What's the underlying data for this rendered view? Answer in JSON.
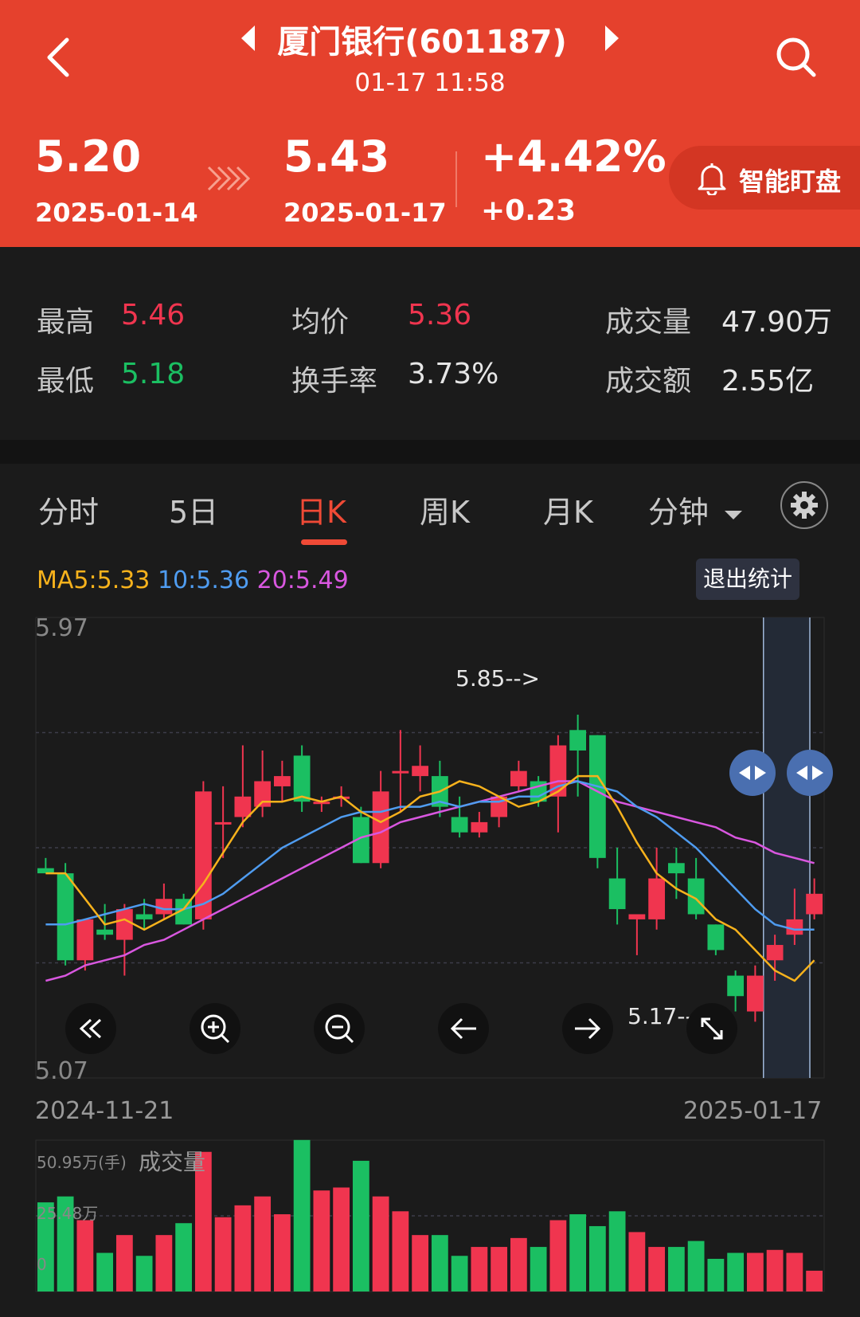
{
  "header": {
    "title": "厦门银行(601187)",
    "datetime": "01-17 11:58",
    "prev_price": "5.20",
    "prev_date": "2025-01-14",
    "cur_price": "5.43",
    "cur_date": "2025-01-17",
    "change_pct": "+4.42%",
    "change_abs": "+0.23",
    "smart_btn": "智能盯盘"
  },
  "stats": {
    "high_label": "最高",
    "high": "5.46",
    "avg_label": "均价",
    "avg": "5.36",
    "vol_label": "成交量",
    "vol": "47.90万",
    "low_label": "最低",
    "low": "5.18",
    "turn_label": "换手率",
    "turn": "3.73%",
    "amt_label": "成交额",
    "amt": "2.55亿"
  },
  "tabs": [
    "分时",
    "5日",
    "日K",
    "周K",
    "月K",
    "分钟"
  ],
  "active_tab": 2,
  "ma": {
    "ma5": "MA5:5.33",
    "ma10": "10:5.36",
    "ma20": "20:5.49"
  },
  "exit_stats": "退出统计",
  "price_axis": {
    "top": "5.97",
    "bottom": "5.07"
  },
  "annotations": {
    "high": "5.85-->",
    "low": "5.17-->"
  },
  "date_axis": {
    "start": "2024-11-21",
    "end": "2025-01-17"
  },
  "volume": {
    "max_label": "50.95万(手)",
    "title": "成交量",
    "mid_label": "25.48万",
    "zero_label": "0"
  },
  "colors": {
    "up": "#f0354f",
    "down": "#1bbf62",
    "ma5": "#f7b21c",
    "ma10": "#4f9cf0",
    "ma20": "#d957e0",
    "header": "#e5412d"
  },
  "icons": [
    "back-icon",
    "prev-stock-icon",
    "next-stock-icon",
    "search-icon",
    "double-chevron-right-icon",
    "bell-icon",
    "settings-gear-icon",
    "dropdown-arrow-icon",
    "rewind-icon",
    "zoom-in-icon",
    "zoom-out-icon",
    "arrow-left-icon",
    "arrow-right-icon",
    "expand-icon"
  ],
  "chart_data": {
    "type": "candlestick",
    "y_range": [
      5.07,
      5.97
    ],
    "candles": [
      {
        "o": 5.48,
        "c": 5.47,
        "h": 5.5,
        "l": 5.47
      },
      {
        "o": 5.47,
        "c": 5.3,
        "h": 5.49,
        "l": 5.29
      },
      {
        "o": 5.3,
        "c": 5.38,
        "h": 5.38,
        "l": 5.28
      },
      {
        "o": 5.36,
        "c": 5.35,
        "h": 5.41,
        "l": 5.34
      },
      {
        "o": 5.34,
        "c": 5.4,
        "h": 5.41,
        "l": 5.27
      },
      {
        "o": 5.39,
        "c": 5.38,
        "h": 5.42,
        "l": 5.36
      },
      {
        "o": 5.39,
        "c": 5.42,
        "h": 5.45,
        "l": 5.38
      },
      {
        "o": 5.42,
        "c": 5.37,
        "h": 5.43,
        "l": 5.37
      },
      {
        "o": 5.38,
        "c": 5.63,
        "h": 5.65,
        "l": 5.36
      },
      {
        "o": 5.57,
        "c": 5.57,
        "h": 5.64,
        "l": 5.5
      },
      {
        "o": 5.58,
        "c": 5.62,
        "h": 5.72,
        "l": 5.56
      },
      {
        "o": 5.6,
        "c": 5.65,
        "h": 5.71,
        "l": 5.58
      },
      {
        "o": 5.64,
        "c": 5.66,
        "h": 5.69,
        "l": 5.61
      },
      {
        "o": 5.7,
        "c": 5.61,
        "h": 5.72,
        "l": 5.59
      },
      {
        "o": 5.61,
        "c": 5.61,
        "h": 5.62,
        "l": 5.59
      },
      {
        "o": 5.62,
        "c": 5.62,
        "h": 5.64,
        "l": 5.6
      },
      {
        "o": 5.58,
        "c": 5.49,
        "h": 5.6,
        "l": 5.49
      },
      {
        "o": 5.49,
        "c": 5.63,
        "h": 5.67,
        "l": 5.48
      },
      {
        "o": 5.67,
        "c": 5.67,
        "h": 5.75,
        "l": 5.59
      },
      {
        "o": 5.66,
        "c": 5.68,
        "h": 5.72,
        "l": 5.63
      },
      {
        "o": 5.66,
        "c": 5.6,
        "h": 5.69,
        "l": 5.58
      },
      {
        "o": 5.58,
        "c": 5.55,
        "h": 5.62,
        "l": 5.54
      },
      {
        "o": 5.55,
        "c": 5.57,
        "h": 5.59,
        "l": 5.54
      },
      {
        "o": 5.58,
        "c": 5.62,
        "h": 5.62,
        "l": 5.56
      },
      {
        "o": 5.64,
        "c": 5.67,
        "h": 5.69,
        "l": 5.63
      },
      {
        "o": 5.65,
        "c": 5.61,
        "h": 5.66,
        "l": 5.6
      },
      {
        "o": 5.62,
        "c": 5.72,
        "h": 5.74,
        "l": 5.55
      },
      {
        "o": 5.75,
        "c": 5.71,
        "h": 5.78,
        "l": 5.62
      },
      {
        "o": 5.74,
        "c": 5.5,
        "h": 5.74,
        "l": 5.48
      },
      {
        "o": 5.46,
        "c": 5.4,
        "h": 5.52,
        "l": 5.37
      },
      {
        "o": 5.38,
        "c": 5.39,
        "h": 5.39,
        "l": 5.31
      },
      {
        "o": 5.38,
        "c": 5.46,
        "h": 5.52,
        "l": 5.36
      },
      {
        "o": 5.49,
        "c": 5.47,
        "h": 5.52,
        "l": 5.42
      },
      {
        "o": 5.46,
        "c": 5.39,
        "h": 5.5,
        "l": 5.38
      },
      {
        "o": 5.37,
        "c": 5.32,
        "h": 5.37,
        "l": 5.31
      },
      {
        "o": 5.27,
        "c": 5.23,
        "h": 5.28,
        "l": 5.2
      },
      {
        "o": 5.2,
        "c": 5.27,
        "h": 5.29,
        "l": 5.18
      },
      {
        "o": 5.3,
        "c": 5.33,
        "h": 5.35,
        "l": 5.26
      },
      {
        "o": 5.35,
        "c": 5.38,
        "h": 5.44,
        "l": 5.33
      },
      {
        "o": 5.39,
        "c": 5.43,
        "h": 5.46,
        "l": 5.38
      }
    ],
    "ma5": [
      5.47,
      5.47,
      5.42,
      5.37,
      5.38,
      5.36,
      5.38,
      5.4,
      5.45,
      5.51,
      5.57,
      5.61,
      5.61,
      5.62,
      5.61,
      5.62,
      5.59,
      5.57,
      5.59,
      5.62,
      5.63,
      5.65,
      5.64,
      5.62,
      5.6,
      5.61,
      5.63,
      5.66,
      5.66,
      5.6,
      5.53,
      5.47,
      5.44,
      5.42,
      5.38,
      5.36,
      5.32,
      5.28,
      5.26,
      5.3
    ],
    "ma10": [
      5.37,
      5.37,
      5.38,
      5.39,
      5.4,
      5.41,
      5.4,
      5.4,
      5.41,
      5.43,
      5.46,
      5.49,
      5.52,
      5.54,
      5.56,
      5.58,
      5.59,
      5.59,
      5.6,
      5.6,
      5.61,
      5.6,
      5.61,
      5.61,
      5.62,
      5.62,
      5.64,
      5.65,
      5.64,
      5.63,
      5.6,
      5.58,
      5.55,
      5.52,
      5.48,
      5.44,
      5.4,
      5.37,
      5.36,
      5.36
    ],
    "ma20": [
      5.26,
      5.27,
      5.29,
      5.3,
      5.31,
      5.33,
      5.34,
      5.36,
      5.38,
      5.4,
      5.42,
      5.44,
      5.46,
      5.48,
      5.5,
      5.52,
      5.54,
      5.55,
      5.57,
      5.58,
      5.59,
      5.6,
      5.61,
      5.62,
      5.63,
      5.64,
      5.65,
      5.65,
      5.63,
      5.61,
      5.6,
      5.59,
      5.58,
      5.57,
      5.56,
      5.54,
      5.53,
      5.51,
      5.5,
      5.49
    ],
    "volume_max": 50.95,
    "volume": [
      30,
      32,
      24,
      13,
      19,
      12,
      19,
      23,
      47,
      25,
      29,
      32,
      26,
      51,
      34,
      35,
      44,
      32,
      27,
      19,
      19,
      12,
      15,
      15,
      18,
      15,
      24,
      26,
      22,
      27,
      20,
      15,
      15,
      17,
      11,
      13,
      13,
      14,
      13,
      7
    ]
  }
}
